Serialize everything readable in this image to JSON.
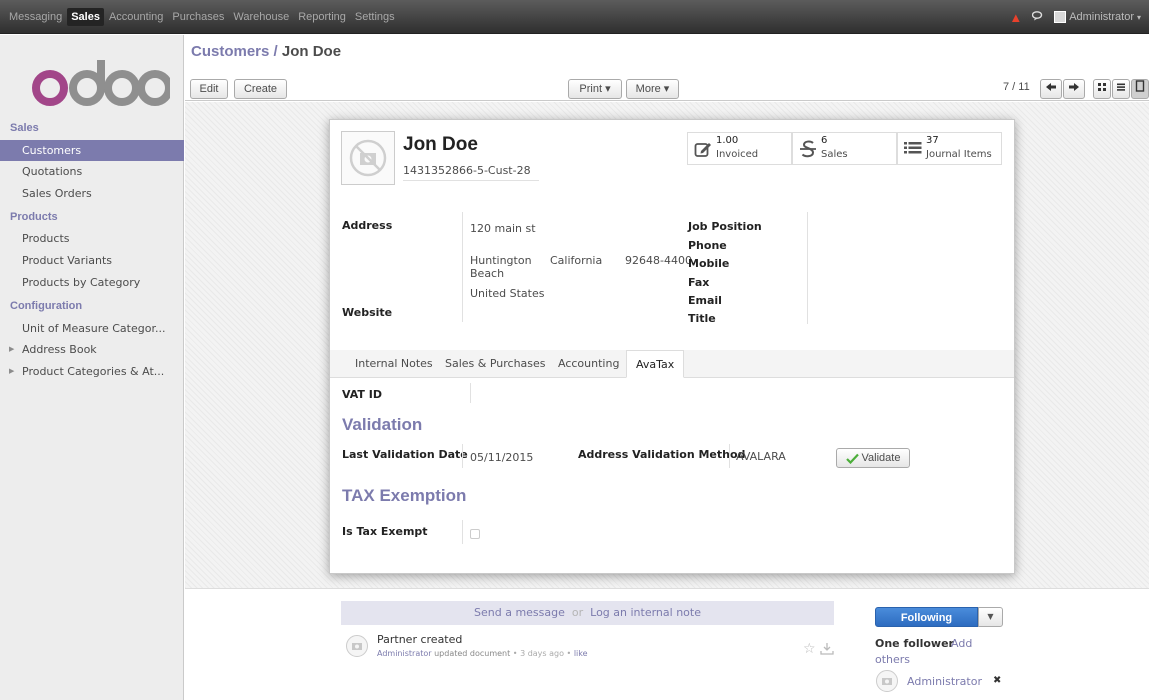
{
  "topbar": {
    "menu": [
      "Messaging",
      "Sales",
      "Accounting",
      "Purchases",
      "Warehouse",
      "Reporting",
      "Settings"
    ],
    "user": "Administrator"
  },
  "sidebar": {
    "sections": [
      {
        "title": "Sales",
        "items": [
          "Customers",
          "Quotations",
          "Sales Orders"
        ]
      },
      {
        "title": "Products",
        "items": [
          "Products",
          "Product Variants",
          "Products by Category"
        ]
      },
      {
        "title": "Configuration",
        "items": [
          "Unit of Measure Categor...",
          "Address Book",
          "Product Categories & At..."
        ]
      }
    ]
  },
  "header": {
    "breadcrumb_parent": "Customers",
    "breadcrumb_sep": " / ",
    "breadcrumb_current": "Jon Doe",
    "edit": "Edit",
    "create": "Create",
    "print": "Print ▾",
    "more": "More ▾",
    "pager": "7 / 11"
  },
  "record": {
    "name": "Jon Doe",
    "ref": "1431352866-5-Cust-28",
    "stats": [
      {
        "value": "1.00",
        "label": "Invoiced",
        "icon": "pencil-square-icon"
      },
      {
        "value": "6",
        "label": "Sales",
        "icon": "strikethrough-s-icon"
      },
      {
        "value": "37",
        "label": "Journal Items",
        "icon": "list-icon"
      }
    ],
    "labels": {
      "address": "Address",
      "website": "Website",
      "job_position": "Job Position",
      "phone": "Phone",
      "mobile": "Mobile",
      "fax": "Fax",
      "email": "Email",
      "title": "Title"
    },
    "address": {
      "street": "120 main st",
      "city_l1": "Huntington",
      "city_l2": "Beach",
      "state": "California",
      "zip": "92648-4400",
      "country": "United States"
    }
  },
  "tabs": [
    "Internal Notes",
    "Sales & Purchases",
    "Accounting",
    "AvaTax"
  ],
  "avatax": {
    "vat_label": "VAT ID",
    "validation_title": "Validation",
    "last_validation_label": "Last Validation Date",
    "last_validation_value": "05/11/2015",
    "method_label": "Address Validation Method",
    "method_value": "AVALARA",
    "validate_button": "Validate",
    "tax_title": "TAX Exemption",
    "tax_exempt_label": "Is Tax Exempt"
  },
  "chatter": {
    "send": "Send a message",
    "or": "or",
    "log": "Log an internal note",
    "msg_title": "Partner created",
    "msg_author": "Administrator",
    "msg_text": " updated document",
    "msg_time": " • 3 days ago • ",
    "msg_like": "like",
    "following": "Following",
    "followers_text": "One follower",
    "add_others_1": "Add",
    "add_others_2": "others",
    "follower_name": "Administrator",
    "remove": "✖"
  },
  "colors": {
    "accent": "#7c7bad",
    "follow": "#3a7bd5"
  }
}
